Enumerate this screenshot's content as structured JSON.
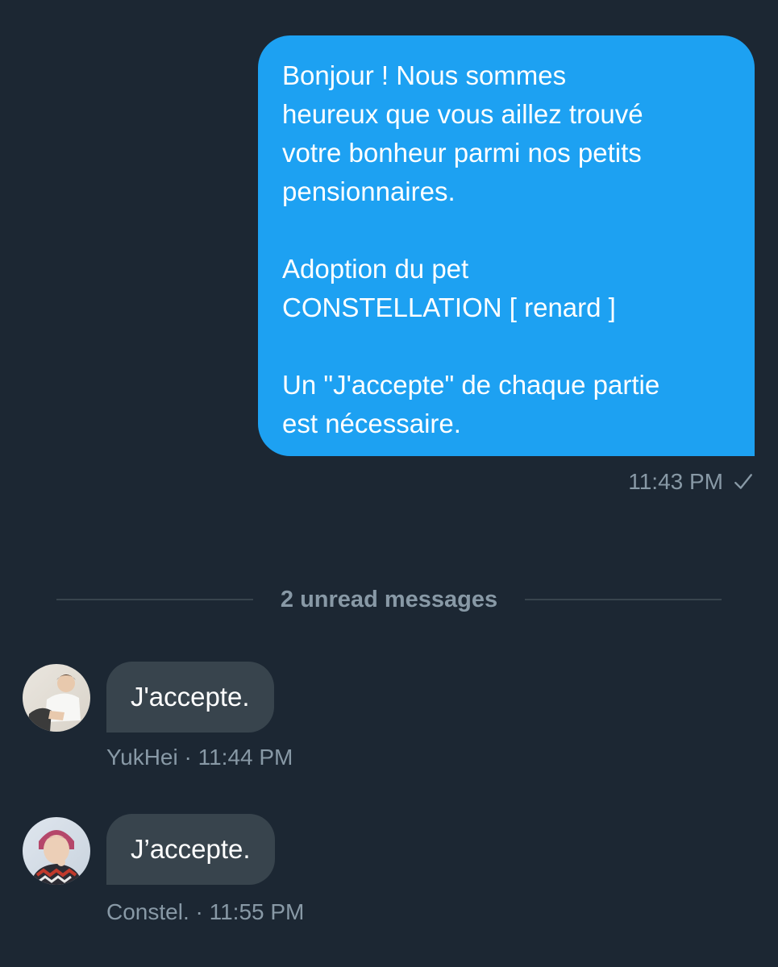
{
  "sent_message": {
    "text": "Bonjour ! Nous sommes\nheureux que vous aillez trouvé\nvotre bonheur parmi nos petits\npensionnaires.\n\nAdoption du pet\nCONSTELLATION [ renard ]\n\nUn \"J'accepte\" de chaque partie\nest nécessaire.",
    "time": "11:43 PM",
    "status_icon": "check-icon"
  },
  "divider": {
    "label": "2 unread messages"
  },
  "received": [
    {
      "text": "J'accepte.",
      "sender": "YukHei",
      "separator": " · ",
      "time": "11:44 PM",
      "avatar_icon": "avatar-photo"
    },
    {
      "text": "J’accepte.",
      "sender": "Constel.",
      "separator": " · ",
      "time": "11:55 PM",
      "avatar_icon": "avatar-photo"
    }
  ],
  "colors": {
    "background": "#1c2733",
    "sent_bubble": "#1da1f2",
    "received_bubble": "#38444d",
    "meta_text": "#8899a6"
  }
}
